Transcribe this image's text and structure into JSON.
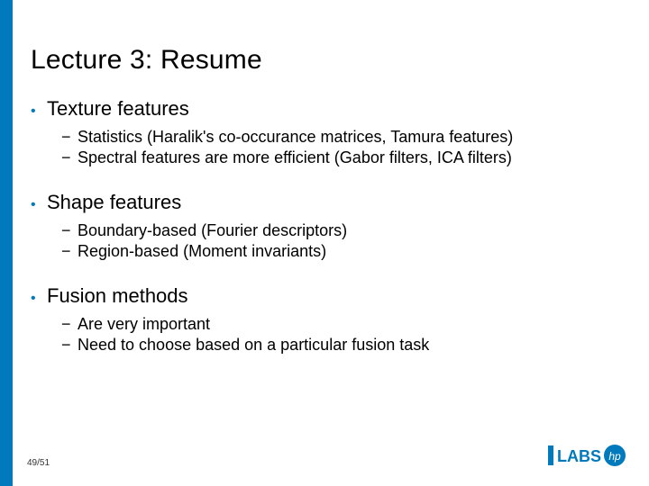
{
  "title": "Lecture 3: Resume",
  "bullets": [
    {
      "label": "Texture features",
      "sub": [
        "Statistics (Haralik's co-occurance matrices, Tamura features)",
        "Spectral features are more efficient (Gabor filters, ICA filters)"
      ]
    },
    {
      "label": "Shape features",
      "sub": [
        "Boundary-based (Fourier descriptors)",
        "Region-based (Moment invariants)"
      ]
    },
    {
      "label": "Fusion methods",
      "sub": [
        "Are very important",
        "Need to choose based on a particular fusion task"
      ]
    }
  ],
  "page": "49/51",
  "logo": {
    "text": "LABS",
    "brand": "hp"
  }
}
